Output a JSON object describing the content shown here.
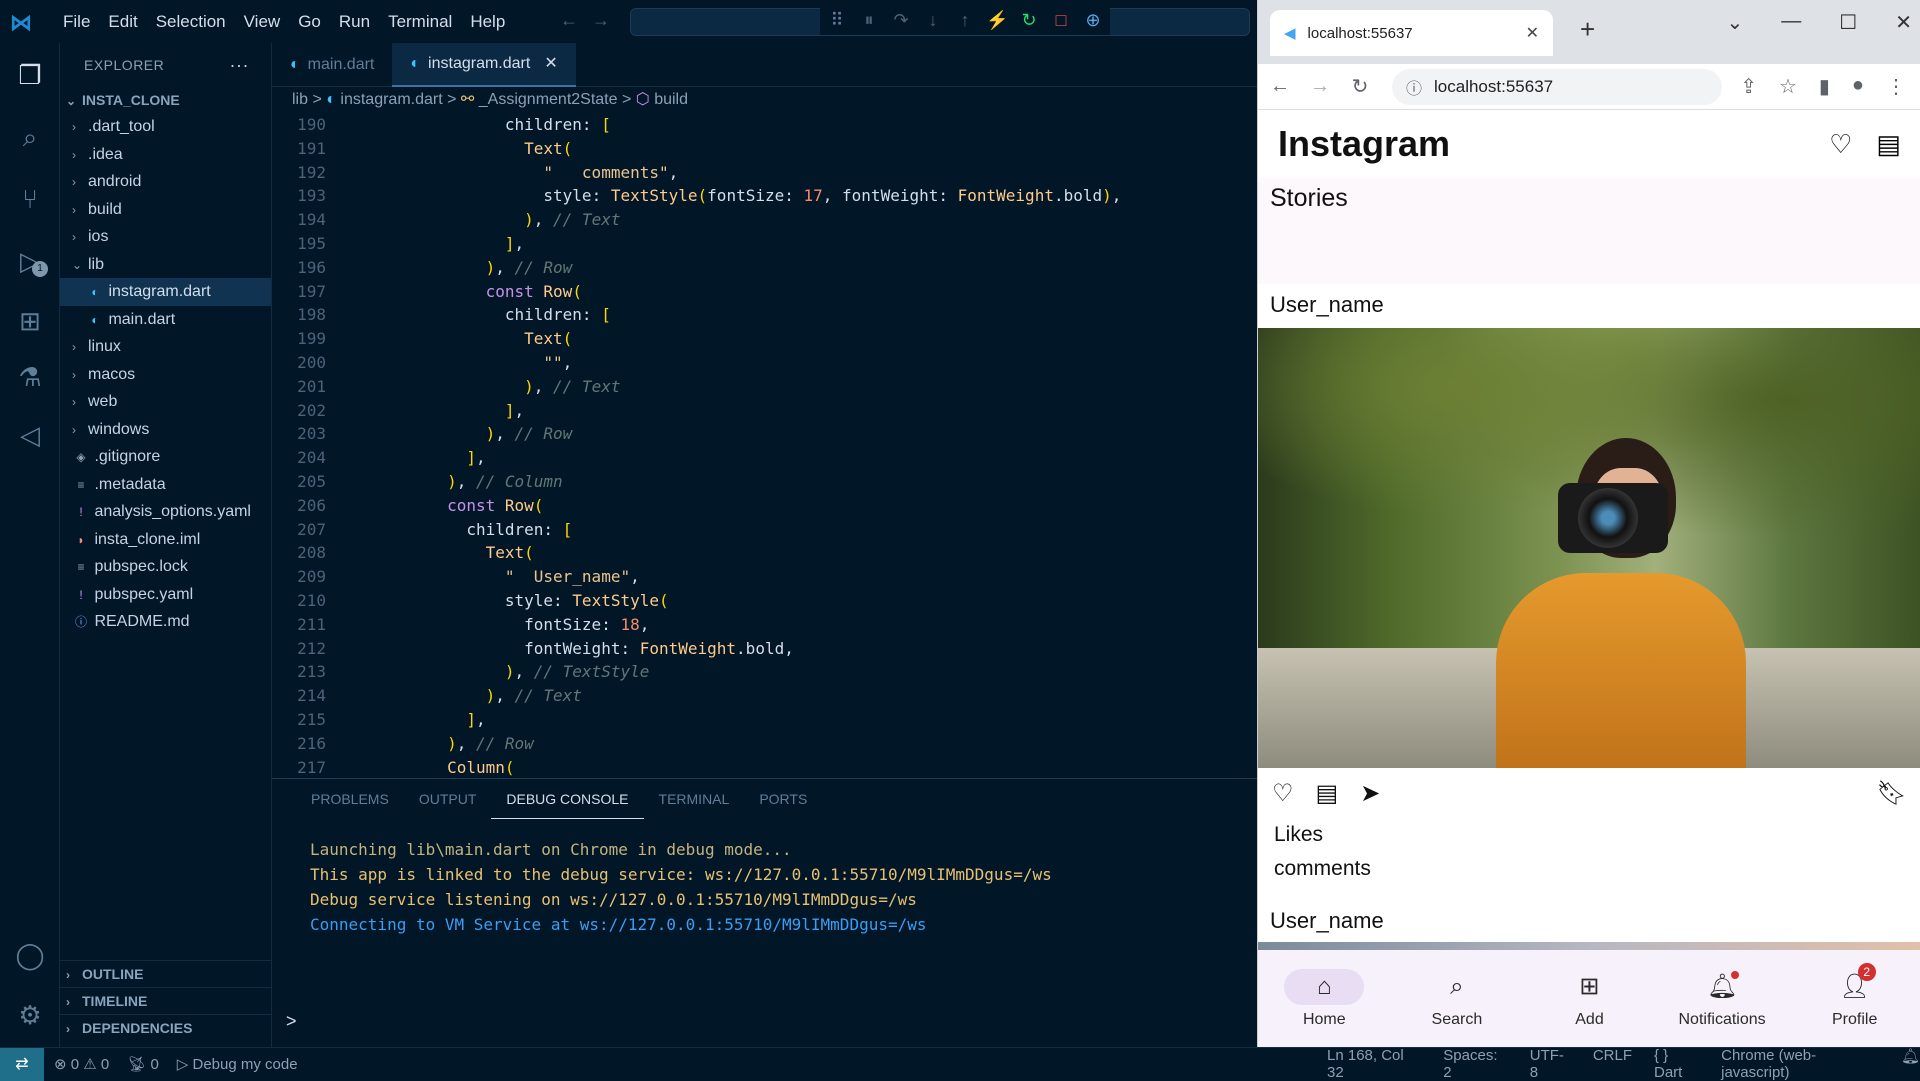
{
  "vscode": {
    "menu": [
      "File",
      "Edit",
      "Selection",
      "View",
      "Go",
      "Run",
      "Terminal",
      "Help"
    ],
    "explorer_title": "EXPLORER",
    "explorer_more": "···",
    "run_badge": "1",
    "project": "INSTA_CLONE",
    "tree": [
      {
        "label": ".dart_tool",
        "type": "folder",
        "open": false
      },
      {
        "label": ".idea",
        "type": "folder",
        "open": false
      },
      {
        "label": "android",
        "type": "folder",
        "open": false
      },
      {
        "label": "build",
        "type": "folder",
        "open": false
      },
      {
        "label": "ios",
        "type": "folder",
        "open": false
      },
      {
        "label": "lib",
        "type": "folder",
        "open": true
      },
      {
        "label": "instagram.dart",
        "type": "dart",
        "child": true,
        "selected": true
      },
      {
        "label": "main.dart",
        "type": "dart",
        "child": true
      },
      {
        "label": "linux",
        "type": "folder",
        "open": false
      },
      {
        "label": "macos",
        "type": "folder",
        "open": false
      },
      {
        "label": "web",
        "type": "folder",
        "open": false
      },
      {
        "label": "windows",
        "type": "folder",
        "open": false
      },
      {
        "label": ".gitignore",
        "type": "git"
      },
      {
        "label": ".metadata",
        "type": "text"
      },
      {
        "label": "analysis_options.yaml",
        "type": "yaml"
      },
      {
        "label": "insta_clone.iml",
        "type": "rss"
      },
      {
        "label": "pubspec.lock",
        "type": "text"
      },
      {
        "label": "pubspec.yaml",
        "type": "yaml"
      },
      {
        "label": "README.md",
        "type": "info"
      }
    ],
    "sections": [
      "OUTLINE",
      "TIMELINE",
      "DEPENDENCIES"
    ],
    "tabs": [
      {
        "label": "main.dart",
        "active": false
      },
      {
        "label": "instagram.dart",
        "active": true
      }
    ],
    "breadcrumb": [
      "lib",
      "instagram.dart",
      "_Assignment2State",
      "build"
    ],
    "breadcrumb_sep": ">",
    "code": [
      {
        "n": "190",
        "t": "              children: ["
      },
      {
        "n": "191",
        "t": "                Text("
      },
      {
        "n": "192",
        "t": "                  \"   comments\","
      },
      {
        "n": "193",
        "t": "                  style: TextStyle(fontSize: 17, fontWeight: FontWeight.bold),"
      },
      {
        "n": "194",
        "t": "                ), // Text"
      },
      {
        "n": "195",
        "t": "              ],"
      },
      {
        "n": "196",
        "t": "            ), // Row"
      },
      {
        "n": "197",
        "t": "            const Row("
      },
      {
        "n": "198",
        "t": "              children: ["
      },
      {
        "n": "199",
        "t": "                Text("
      },
      {
        "n": "200",
        "t": "                  \"\","
      },
      {
        "n": "201",
        "t": "                ), // Text"
      },
      {
        "n": "202",
        "t": "              ],"
      },
      {
        "n": "203",
        "t": "            ), // Row"
      },
      {
        "n": "204",
        "t": "          ],"
      },
      {
        "n": "205",
        "t": "        ), // Column"
      },
      {
        "n": "206",
        "t": "        const Row("
      },
      {
        "n": "207",
        "t": "          children: ["
      },
      {
        "n": "208",
        "t": "            Text("
      },
      {
        "n": "209",
        "t": "              \"  User_name\","
      },
      {
        "n": "210",
        "t": "              style: TextStyle("
      },
      {
        "n": "211",
        "t": "                fontSize: 18,"
      },
      {
        "n": "212",
        "t": "                fontWeight: FontWeight.bold,"
      },
      {
        "n": "213",
        "t": "              ), // TextStyle"
      },
      {
        "n": "214",
        "t": "            ), // Text"
      },
      {
        "n": "215",
        "t": "          ],"
      },
      {
        "n": "216",
        "t": "        ), // Row"
      },
      {
        "n": "217",
        "t": "        Column("
      }
    ],
    "panel_tabs": [
      {
        "label": "PROBLEMS",
        "active": false
      },
      {
        "label": "OUTPUT",
        "active": false
      },
      {
        "label": "DEBUG CONSOLE",
        "active": true
      },
      {
        "label": "TERMINAL",
        "active": false
      },
      {
        "label": "PORTS",
        "active": false
      }
    ],
    "console": [
      {
        "text": "Launching lib\\main.dart on Chrome in debug mode...",
        "color": "#c3b37f"
      },
      {
        "text": "This app is linked to the debug service: ws://127.0.0.1:55710/M9lIMmDDgus=/ws",
        "color": "#e8c070"
      },
      {
        "text": "Debug service listening on ws://127.0.0.1:55710/M9lIMmDDgus=/ws",
        "color": "#e8c070"
      },
      {
        "text": "Connecting to VM Service at ws://127.0.0.1:55710/M9lIMmDDgus=/ws",
        "color": "#3c9df2"
      }
    ],
    "prompt": ">",
    "status": {
      "errors": "0",
      "warnings": "0",
      "ports": "0",
      "debug": "Debug my code",
      "position": "Ln 168, Col 32",
      "spaces": "Spaces: 2",
      "encoding": "UTF-8",
      "eol": "CRLF",
      "language": "Dart",
      "device": "Chrome (web-javascript)"
    }
  },
  "browser": {
    "tab_title": "localhost:55637",
    "url": "localhost:55637",
    "app": {
      "title": "Instagram",
      "stories": "Stories",
      "user1": "User_name",
      "likes": "Likes",
      "comments": "comments",
      "user2": "User_name"
    },
    "nav": [
      {
        "label": "Home",
        "icon": "home-icon",
        "active": true
      },
      {
        "label": "Search",
        "icon": "search-icon"
      },
      {
        "label": "Add",
        "icon": "add-box-icon"
      },
      {
        "label": "Notifications",
        "icon": "bell-icon",
        "dot": true
      },
      {
        "label": "Profile",
        "icon": "account-icon",
        "badge": "2"
      }
    ]
  }
}
